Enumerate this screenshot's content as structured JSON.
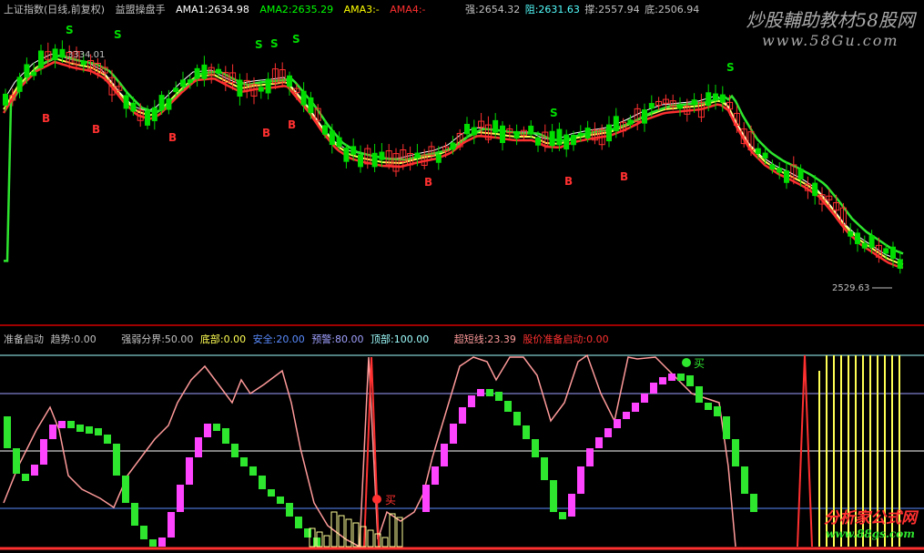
{
  "main": {
    "title": "上证指数(日线,前复权)",
    "indicator": "益盟操盘手",
    "ama1": "AMA1:2634.98",
    "ama2": "AMA2:2635.29",
    "ama3": "AMA3:-",
    "ama4": "AMA4:-",
    "strong": "强:2654.32",
    "resist": "阻:2631.63",
    "support": "撑:2557.94",
    "bottom": "底:2506.94",
    "high_label": "3334.01",
    "low_label": "2529.63",
    "signal_s": "S",
    "signal_b": "B"
  },
  "sub": {
    "name": "准备启动",
    "trend": "趋势:0.00",
    "divide": "强弱分界:50.00",
    "base": "底部:0.00",
    "safe": "安全:20.00",
    "warn": "预警:80.00",
    "top": "顶部:100.00",
    "short": "超短线:23.39",
    "price_ready": "股价准备启动:0.00",
    "buy": "买"
  },
  "watermark": {
    "top_line1": "炒股輔助教材58股网",
    "top_line2": "www.58Gu.com",
    "bottom_line1": "分析家公式网",
    "bottom_line2": "www.88gs.com"
  },
  "colors": {
    "up": "#ff3030",
    "down": "#00dd00",
    "yellow": "#ffff54",
    "white": "#ffffff",
    "pink": "#ff9a9a",
    "magenta": "#ff44ff",
    "green": "#2ee62e",
    "cyan": "#54ffff"
  }
}
